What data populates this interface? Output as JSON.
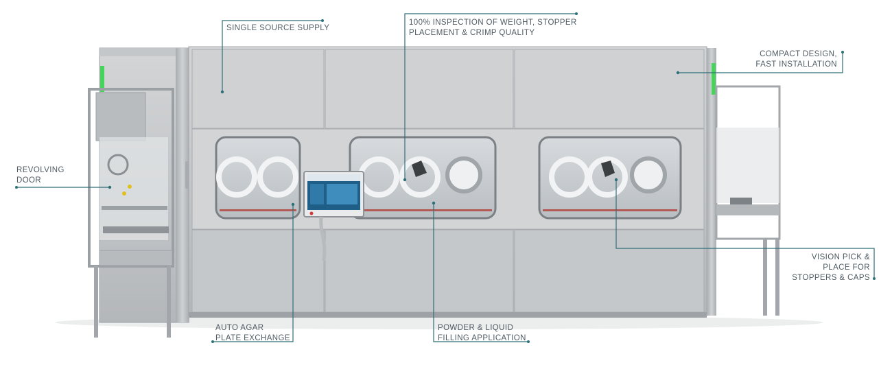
{
  "colors": {
    "accent_line": "#2e6f78",
    "label_text": "#4f5b63",
    "status_light": "#46d45a",
    "steel_light": "#c9cbcd",
    "steel_dark": "#8f9397",
    "glass": "#e4e7ea",
    "hmi_blue": "#1f5e86"
  },
  "callouts": [
    {
      "id": "single-source-supply",
      "text": "SINGLE SOURCE SUPPLY"
    },
    {
      "id": "inspection",
      "text": "100% INSPECTION OF WEIGHT, STOPPER\nPLACEMENT & CRIMP QUALITY"
    },
    {
      "id": "compact-design",
      "text": "COMPACT DESIGN,\nFAST INSTALLATION"
    },
    {
      "id": "revolving-door",
      "text": "REVOLVING\nDOOR"
    },
    {
      "id": "vision-pick",
      "text": "VISION PICK &\nPLACE FOR\nSTOPPERS & CAPS"
    },
    {
      "id": "auto-agar",
      "text": "AUTO AGAR\nPLATE EXCHANGE"
    },
    {
      "id": "powder-liquid",
      "text": "POWDER & LIQUID\nFILLING APPLICATION"
    }
  ]
}
